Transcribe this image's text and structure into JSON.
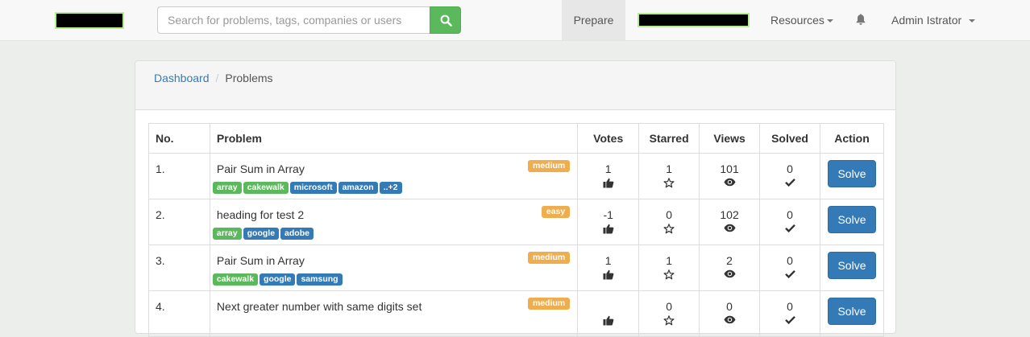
{
  "colors": {
    "primary": "#337ab7",
    "success": "#5cb85c",
    "warning": "#f0ad4e"
  },
  "navbar": {
    "search": {
      "placeholder": "Search for problems, tags, companies or users",
      "value": "",
      "button_icon": "search-icon"
    },
    "prepare_label": "Prepare",
    "resources_label": "Resources",
    "bell_icon": "bell-icon",
    "user_label": "Admin Istrator"
  },
  "breadcrumb": {
    "home": "Dashboard",
    "current": "Problems"
  },
  "table": {
    "headers": {
      "no": "No.",
      "problem": "Problem",
      "votes": "Votes",
      "starred": "Starred",
      "views": "Views",
      "solved": "Solved",
      "action": "Action"
    },
    "solve_label": "Solve",
    "rows": [
      {
        "no": "1.",
        "title": "Pair Sum in Array",
        "difficulty": "medium",
        "tags": [
          {
            "label": "array",
            "kind": "topic"
          },
          {
            "label": "cakewalk",
            "kind": "topic"
          },
          {
            "label": "microsoft",
            "kind": "company"
          },
          {
            "label": "amazon",
            "kind": "company"
          },
          {
            "label": "..+2",
            "kind": "company"
          }
        ],
        "votes": "1",
        "starred": "1",
        "views": "101",
        "solved": "0"
      },
      {
        "no": "2.",
        "title": "heading for test 2",
        "difficulty": "easy",
        "tags": [
          {
            "label": "array",
            "kind": "topic"
          },
          {
            "label": "google",
            "kind": "company"
          },
          {
            "label": "adobe",
            "kind": "company"
          }
        ],
        "votes": "-1",
        "starred": "0",
        "views": "102",
        "solved": "0"
      },
      {
        "no": "3.",
        "title": "Pair Sum in Array",
        "difficulty": "medium",
        "tags": [
          {
            "label": "cakewalk",
            "kind": "topic"
          },
          {
            "label": "google",
            "kind": "company"
          },
          {
            "label": "samsung",
            "kind": "company"
          }
        ],
        "votes": "1",
        "starred": "1",
        "views": "2",
        "solved": "0"
      },
      {
        "no": "4.",
        "title": "Next greater number with same digits set",
        "difficulty": "medium",
        "tags": [],
        "votes": "",
        "starred": "0",
        "views": "0",
        "solved": "0"
      }
    ]
  }
}
